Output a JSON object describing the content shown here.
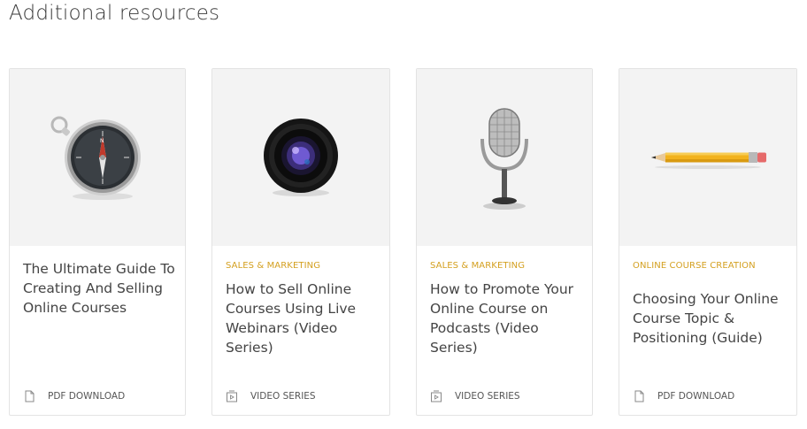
{
  "heading": "Additional resources",
  "cards": [
    {
      "category": "",
      "title": "The Ultimate Guide To Creating And Selling Online Courses",
      "meta_icon": "document-icon",
      "meta_label": "PDF DOWNLOAD",
      "image": "compass-image"
    },
    {
      "category": "SALES & MARKETING",
      "title": "How to Sell Online Courses Using Live Webinars (Video Series)",
      "meta_icon": "video-icon",
      "meta_label": "VIDEO SERIES",
      "image": "camera-lens-image"
    },
    {
      "category": "SALES & MARKETING",
      "title": "How to Promote Your Online Course on Podcasts (Video Series)",
      "meta_icon": "video-icon",
      "meta_label": "VIDEO SERIES",
      "image": "microphone-image"
    },
    {
      "category": "ONLINE COURSE CREATION",
      "title": "Choosing Your Online Course Topic & Positioning (Guide)",
      "meta_icon": "document-icon",
      "meta_label": "PDF DOWNLOAD",
      "image": "pencil-image"
    }
  ],
  "colors": {
    "category": "#d4a020",
    "thumb_bg": "#f3f3f3",
    "border": "#e3e3e3"
  }
}
